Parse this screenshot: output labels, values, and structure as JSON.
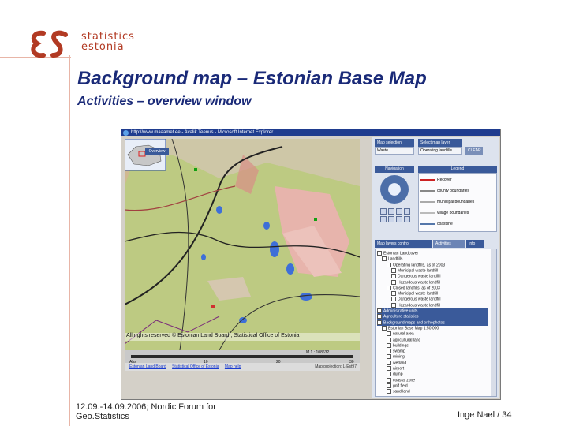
{
  "logo": {
    "line1": "statistics",
    "line2": "estonia"
  },
  "slide": {
    "title": "Background map – Estonian Base Map",
    "subtitle": "Activities – overview window"
  },
  "footer": {
    "left": "12.09.-14.09.2006; Nordic Forum for Geo.Statistics",
    "right": "Inge Nael / 34"
  },
  "screenshot": {
    "window_title": "http://www.maaamet.ee - Avalik Teenus - Microsoft Internet Explorer",
    "overview_tab": "Overview",
    "copyright": "All rights reserved © Estonian Land Board ; Statistical Office of Estonia",
    "scale_labels": [
      "Abs",
      "10",
      "20",
      "30"
    ],
    "scale_value": "M 1 : 108632",
    "links": [
      "Estonian Land Board",
      "Statistical Office of Estonia",
      "Map help"
    ],
    "coords_text": "Map projection: L-Est97",
    "panel": {
      "map_selector": "Map selection",
      "map_value": "Waste",
      "layer_selector": "Select map layer",
      "layer_value": "Operating landfills",
      "clear_button": "CLEAR",
      "navigation_label": "Navigation",
      "legend_label": "Legend",
      "legend_items": [
        {
          "label": "Recover",
          "color": "#cc2222"
        },
        {
          "label": "county boundaries",
          "color": "#888888"
        },
        {
          "label": "municipal boundaries",
          "color": "#aaaaaa"
        },
        {
          "label": "village boundaries",
          "color": "#bbbbbb"
        },
        {
          "label": "coastline",
          "color": "#5577aa"
        }
      ],
      "tabs": [
        "Map layers control",
        "Activities",
        "Info"
      ],
      "tree": [
        {
          "label": "Estonian Landcover",
          "hl": false,
          "indent": 0
        },
        {
          "label": "Landfills",
          "hl": false,
          "indent": 1
        },
        {
          "label": "Operating landfills, as of 2003",
          "hl": false,
          "indent": 2
        },
        {
          "label": "Municipal waste landfill",
          "hl": false,
          "indent": 3
        },
        {
          "label": "Dangerous waste landfill",
          "hl": false,
          "indent": 3
        },
        {
          "label": "Hazardous waste landfill",
          "hl": false,
          "indent": 3
        },
        {
          "label": "Closed landfills, as of 2003",
          "hl": false,
          "indent": 2
        },
        {
          "label": "Municipal waste landfill",
          "hl": false,
          "indent": 3
        },
        {
          "label": "Dangerous waste landfill",
          "hl": false,
          "indent": 3
        },
        {
          "label": "Hazardous waste landfill",
          "hl": false,
          "indent": 3
        },
        {
          "label": "Administrative units",
          "hl": true,
          "indent": 0
        },
        {
          "label": "Agriculture statistics",
          "hl": true,
          "indent": 0
        },
        {
          "label": "Background maps and orthophotos",
          "hl": true,
          "indent": 0
        },
        {
          "label": "Estonian Base Map 1:50 000",
          "hl": false,
          "indent": 1
        },
        {
          "label": "natural area",
          "hl": false,
          "indent": 2
        },
        {
          "label": "agricultural land",
          "hl": false,
          "indent": 2
        },
        {
          "label": "buildings",
          "hl": false,
          "indent": 2
        },
        {
          "label": "swamp",
          "hl": false,
          "indent": 2
        },
        {
          "label": "mining",
          "hl": false,
          "indent": 2
        },
        {
          "label": "wetland",
          "hl": false,
          "indent": 2
        },
        {
          "label": "airport",
          "hl": false,
          "indent": 2
        },
        {
          "label": "dump",
          "hl": false,
          "indent": 2
        },
        {
          "label": "coastal zone",
          "hl": false,
          "indent": 2
        },
        {
          "label": "golf field",
          "hl": false,
          "indent": 2
        },
        {
          "label": "sand land",
          "hl": false,
          "indent": 2
        }
      ]
    }
  },
  "colors": {
    "title": "#1a2a78",
    "brand": "#b23a23",
    "map_base": "#b8c77a",
    "panel_header": "#3a5a9a"
  }
}
